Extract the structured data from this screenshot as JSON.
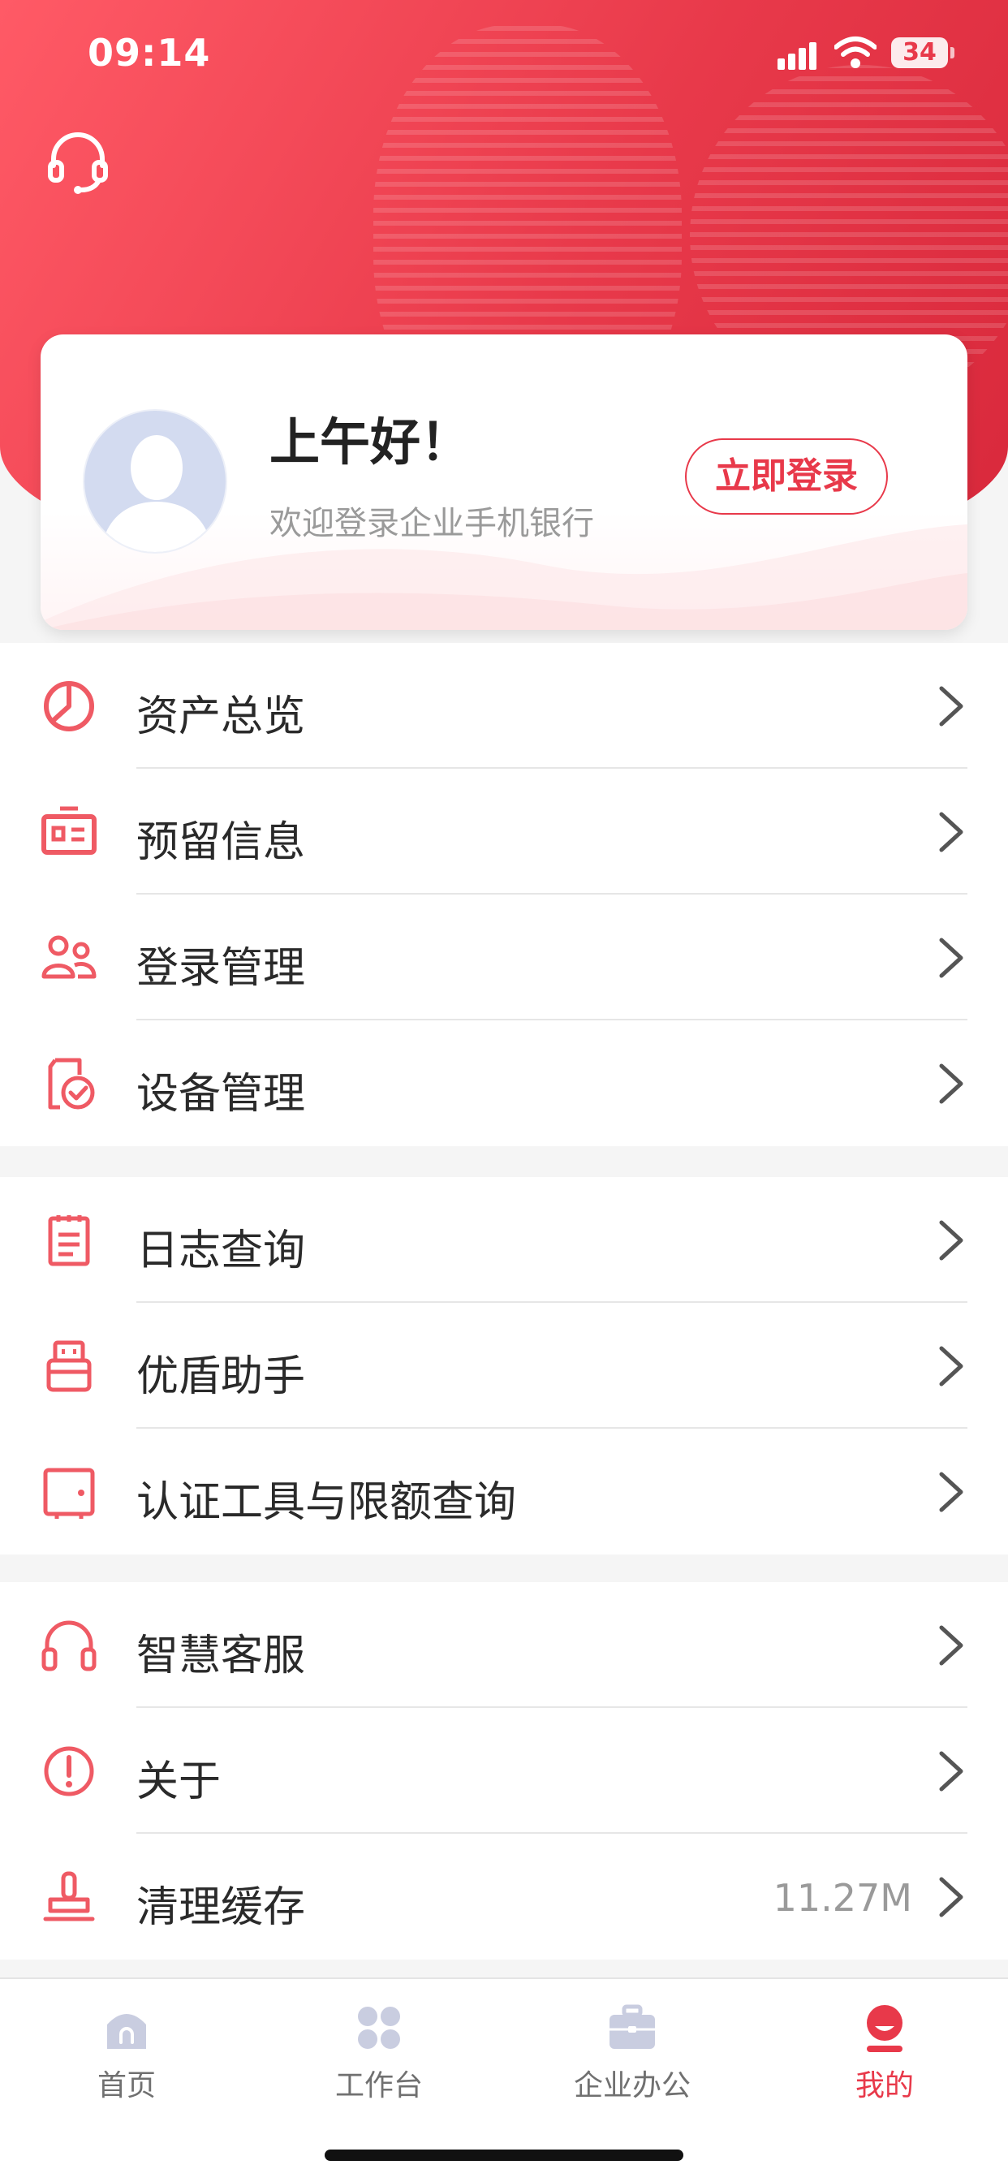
{
  "status": {
    "time": "09:14",
    "battery": "34"
  },
  "profile": {
    "greeting": "上午好！",
    "welcome": "欢迎登录企业手机银行",
    "login_label": "立即登录"
  },
  "menu_group_1": [
    {
      "label": "资产总览",
      "icon": "pie-chart-icon"
    },
    {
      "label": "预留信息",
      "icon": "id-card-icon"
    },
    {
      "label": "登录管理",
      "icon": "users-icon"
    },
    {
      "label": "设备管理",
      "icon": "device-check-icon"
    }
  ],
  "menu_group_2": [
    {
      "label": "日志查询",
      "icon": "log-icon"
    },
    {
      "label": "优盾助手",
      "icon": "usb-key-icon"
    },
    {
      "label": "认证工具与限额查询",
      "icon": "auth-tool-icon"
    }
  ],
  "menu_group_3": [
    {
      "label": "智慧客服",
      "icon": "headset-icon"
    },
    {
      "label": "关于",
      "icon": "info-icon"
    },
    {
      "label": "清理缓存",
      "icon": "stamp-icon",
      "value": "11.27M"
    }
  ],
  "tabs": [
    {
      "label": "首页",
      "icon": "home-icon",
      "active": false
    },
    {
      "label": "工作台",
      "icon": "grid-icon",
      "active": false
    },
    {
      "label": "企业办公",
      "icon": "briefcase-icon",
      "active": false
    },
    {
      "label": "我的",
      "icon": "profile-icon",
      "active": true
    }
  ],
  "colors": {
    "accent": "#e8394a",
    "icon_red": "#ef5a64",
    "tab_inactive_icon": "#c9cde0"
  }
}
